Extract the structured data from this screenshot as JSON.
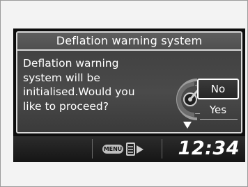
{
  "dialog": {
    "title": "Deflation warning system",
    "message_lines": [
      "Deflation warning",
      "system will be",
      "initialised.Would you",
      "like to proceed?"
    ],
    "options": {
      "no": "No",
      "yes": "Yes",
      "selected": "No"
    }
  },
  "statusbar": {
    "menu_badge": "MENU",
    "clock": "12:34"
  },
  "icons": {
    "selector_dial": "selector-dial-icon",
    "down_arrow": "down-arrow-icon",
    "info_swap": "info-swap-icon"
  }
}
